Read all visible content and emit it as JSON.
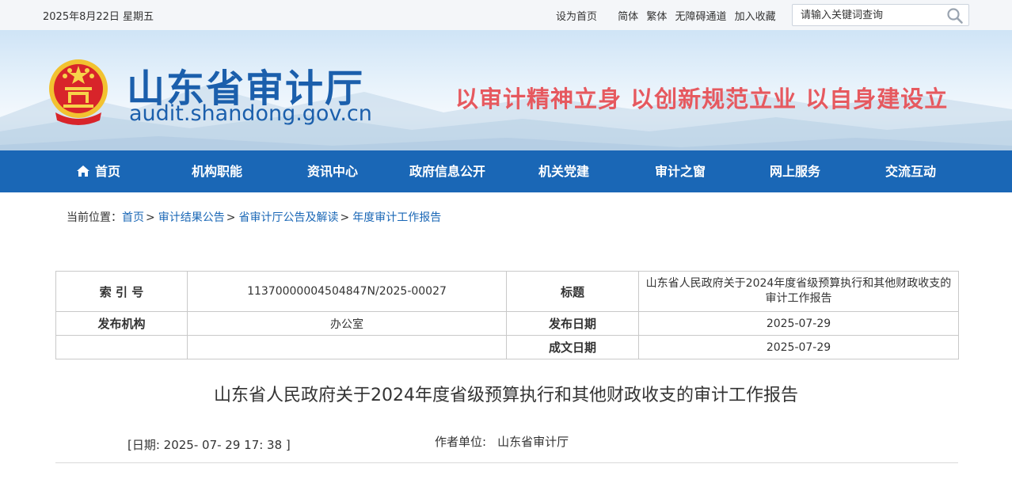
{
  "topbar": {
    "date": "2025年8月22日 星期五",
    "set_homepage": "设为首页",
    "simplified": "简体",
    "traditional": "繁体",
    "accessibility": "无障碍通道",
    "add_favorite": "加入收藏",
    "search_placeholder": "请输入关键词查询",
    "search_icon": "search-icon"
  },
  "header": {
    "site_name": "山东省审计厅",
    "site_url": "audit.shandong.gov.cn",
    "slogan": "以审计精神立身 以创新规范立业 以自身建设立",
    "emblem": "national-emblem",
    "brand_color": "#1b5fac",
    "slogan_color": "#e6595f"
  },
  "nav": {
    "color": "#1a67b6",
    "home_icon": "home-icon",
    "items": [
      "首页",
      "机构职能",
      "资讯中心",
      "政府信息公开",
      "机关党建",
      "审计之窗",
      "网上服务",
      "交流互动"
    ]
  },
  "breadcrumb": {
    "prefix": "当前位置：",
    "links": [
      "首页",
      "审计结果公告",
      "省审计厅公告及解读",
      "年度审计工作报告"
    ],
    "separator": ">"
  },
  "meta_table": {
    "index_label": "索 引 号",
    "index_value": "11370000004504847N/2025-00027",
    "title_label": "标题",
    "title_value": "山东省人民政府关于2024年度省级预算执行和其他财政收支的审计工作报告",
    "publisher_label": "发布机构",
    "publisher_value": "办公室",
    "publish_date_label": "发布日期",
    "publish_date_value": "2025-07-29",
    "created_date_label": "成文日期",
    "created_date_value": "2025-07-29"
  },
  "article": {
    "headline": "山东省人民政府关于2024年度省级预算执行和其他财政收支的审计工作报告",
    "date_line": "[日期:   2025- 07- 29 17: 38 ]",
    "author_label": "作者单位:",
    "author_value": "山东省审计厅"
  }
}
